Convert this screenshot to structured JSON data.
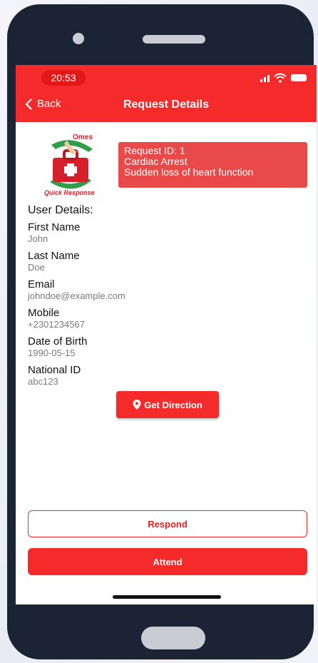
{
  "status_bar": {
    "time": "20:53"
  },
  "header": {
    "back_label": "Back",
    "title": "Request Details"
  },
  "logo": {
    "top_text": "Omes",
    "bottom_text": "Quick Response"
  },
  "request": {
    "id_line": "Request ID: 1",
    "type": "Cardiac Arrest",
    "description": "Sudden loss of heart function"
  },
  "user_details": {
    "heading": "User Details:",
    "fields": [
      {
        "label": "First Name",
        "value": "John"
      },
      {
        "label": "Last Name",
        "value": "Doe"
      },
      {
        "label": "Email",
        "value": "johndoe@example.com"
      },
      {
        "label": "Mobile",
        "value": "+2301234567"
      },
      {
        "label": "Date of Birth",
        "value": "1990-05-15"
      },
      {
        "label": "National ID",
        "value": "abc123"
      }
    ]
  },
  "actions": {
    "direction_label": "Get Direction",
    "respond_label": "Respond",
    "attend_label": "Attend"
  },
  "icons": {
    "back": "chevron-left-icon",
    "direction": "map-pin-icon",
    "signal": "signal-icon",
    "wifi": "wifi-icon",
    "battery": "battery-icon"
  },
  "colors": {
    "primary": "#f52a2a",
    "request_box": "#e84a4a",
    "phone_frame": "#1b2434"
  }
}
